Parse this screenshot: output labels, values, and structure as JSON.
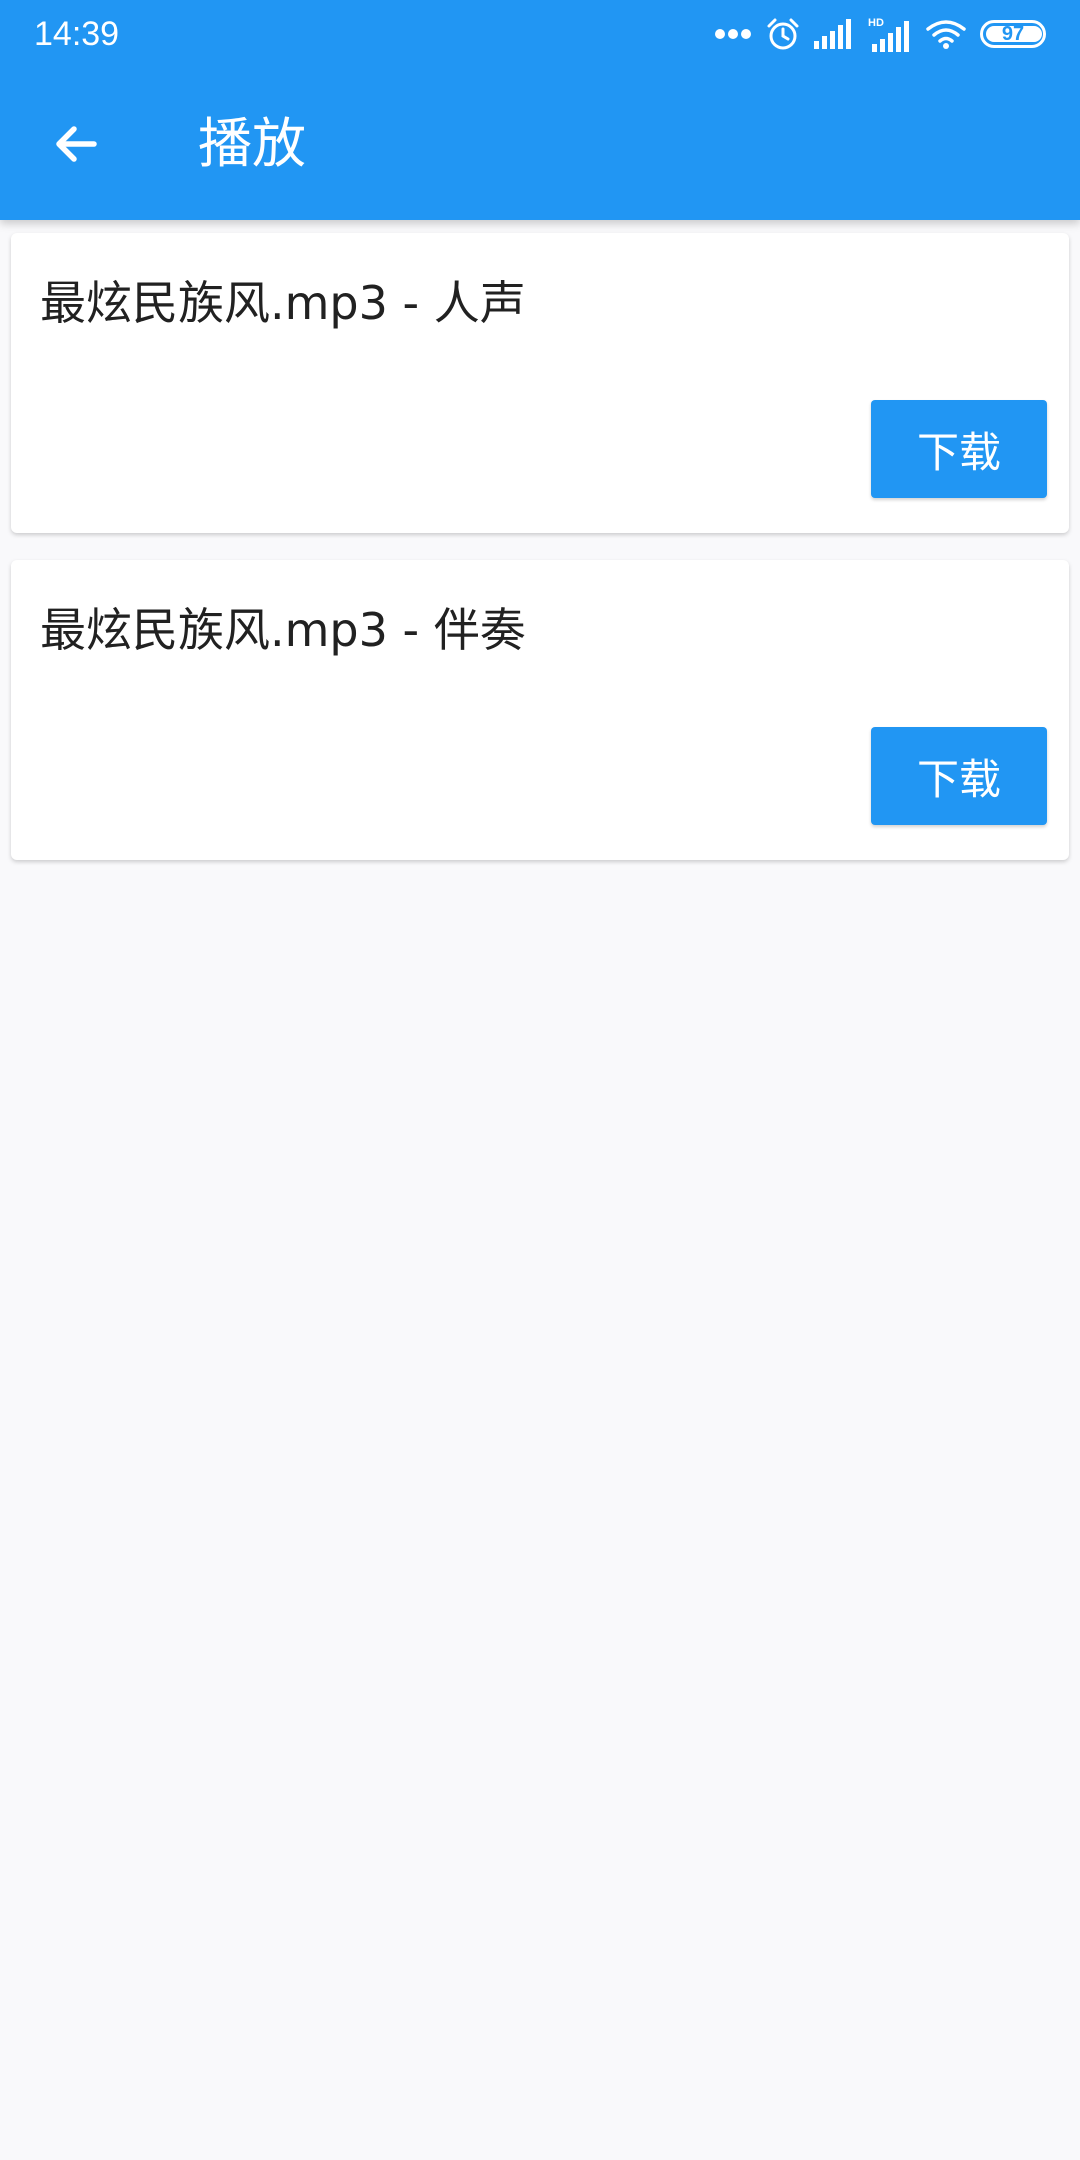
{
  "status_bar": {
    "time": "14:39",
    "icons": [
      "more-dots-icon",
      "alarm-icon",
      "signal-icon",
      "signal-hd-icon",
      "wifi-icon"
    ],
    "hd_label": "HD",
    "battery_percent": "97"
  },
  "app_bar": {
    "back_icon": "arrow-back-icon",
    "title": "播放"
  },
  "items": [
    {
      "title": "最炫民族风.mp3 - 人声",
      "button_label": "下载"
    },
    {
      "title": "最炫民族风.mp3 - 伴奏",
      "button_label": "下载"
    }
  ],
  "colors": {
    "primary": "#2196f3",
    "background": "#f9f9fb",
    "card": "#ffffff",
    "text": "#212121"
  }
}
